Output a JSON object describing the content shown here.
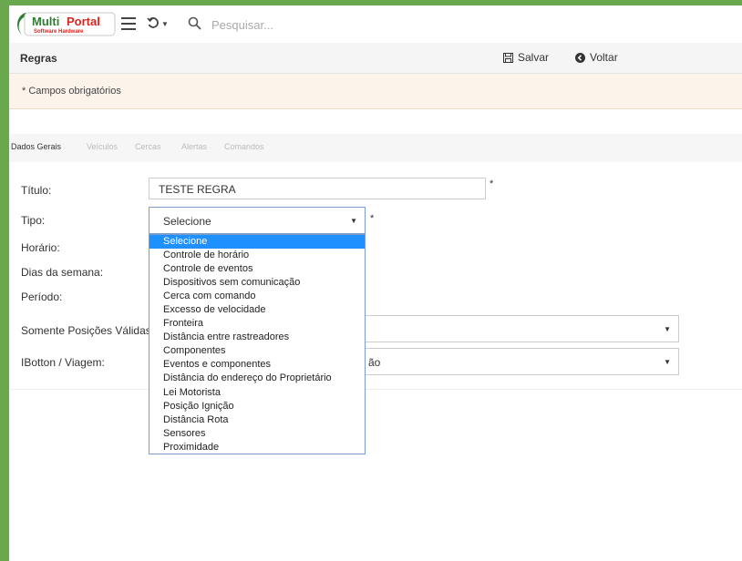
{
  "brand": {
    "name_part1": "Multi",
    "name_part2": "Portal",
    "tagline": "Software Hardware"
  },
  "search": {
    "placeholder": "Pesquisar..."
  },
  "header": {
    "title": "Regras",
    "save_label": "Salvar",
    "back_label": "Voltar"
  },
  "required_note": "* Campos obrigatórios",
  "tabs": [
    {
      "label": "Dados Gerais",
      "active": true
    },
    {
      "label": "Veículos",
      "active": false
    },
    {
      "label": "Cercas",
      "active": false
    },
    {
      "label": "Alertas",
      "active": false
    },
    {
      "label": "Comandos",
      "active": false
    }
  ],
  "form": {
    "titulo_label": "Título:",
    "titulo_value": "TESTE REGRA",
    "tipo_label": "Tipo:",
    "tipo_value": "Selecione",
    "horario_label": "Horário:",
    "dias_label": "Dias da semana:",
    "periodo_label": "Período:",
    "somente_label": "Somente Posições Válidas:",
    "ibotton_label": "IBotton / Viagem:",
    "ibotton_value_partial": "ão",
    "required_mark": "*"
  },
  "dropdown_options": [
    "Selecione",
    "Controle de horário",
    "Controle de eventos",
    "Dispositivos sem comunicação",
    "Cerca com comando",
    "Excesso de velocidade",
    "Fronteira",
    "Distância entre rastreadores",
    "Componentes",
    "Eventos e componentes",
    "Distância do endereço do Proprietário",
    "Lei Motorista",
    "Posição Ignição",
    "Distância Rota",
    "Sensores",
    "Proximidade"
  ],
  "colors": {
    "frame": "#6aa84f",
    "brand_red": "#d7261e",
    "brand_green": "#2e7d32",
    "selected_option": "#1e90ff"
  },
  "icons": [
    "menu-icon",
    "history-icon",
    "search-icon",
    "save-icon",
    "back-icon",
    "caret-down-icon"
  ]
}
